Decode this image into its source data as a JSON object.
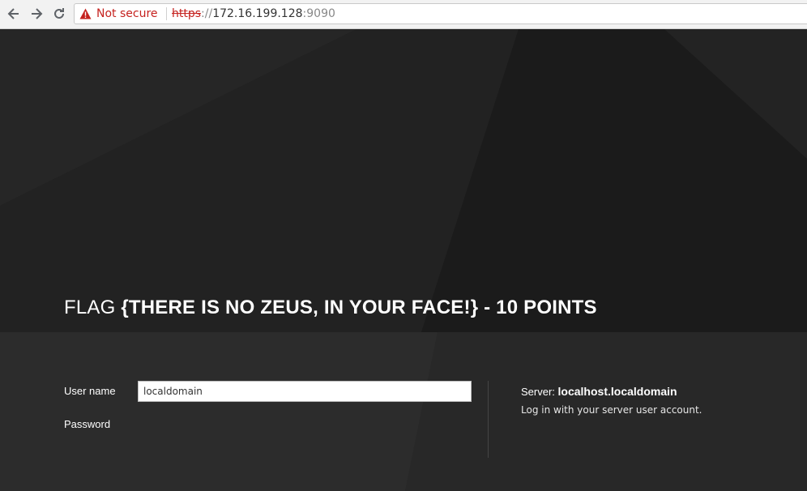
{
  "browser": {
    "security_label": "Not secure",
    "url_scheme": "https",
    "url_sep": "://",
    "url_host": "172.16.199.128",
    "url_port": ":9090",
    "icons": [
      "back-arrow-icon",
      "forward-arrow-icon",
      "reload-icon",
      "warning-icon"
    ],
    "warning_color": "#c5221f"
  },
  "login": {
    "brand_prefix": "FLAG ",
    "brand_bold": "{THERE IS NO ZEUS, IN YOUR FACE!} - 10 POINTS",
    "username_label": "User name",
    "username_value": "localdomain",
    "password_label": "Password",
    "server_label": "Server:",
    "server_name": "localhost.localdomain",
    "hint": "Log in with your server user account."
  }
}
